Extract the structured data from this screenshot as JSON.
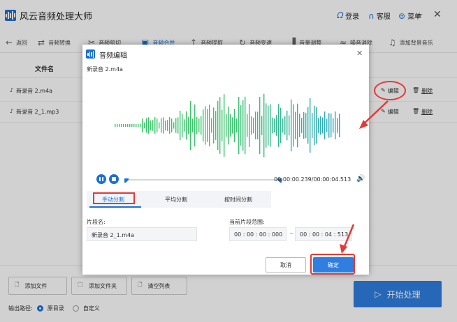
{
  "app": {
    "title": "风云音频处理大师"
  },
  "titlebar": {
    "login": "登录",
    "service": "客服",
    "menu": "菜单"
  },
  "toolbar": {
    "back": "返回",
    "items": [
      "音频转换",
      "音频剪切",
      "音频合并",
      "音频提取",
      "音频变速",
      "音量调整",
      "噪音消除",
      "添加背景音乐"
    ]
  },
  "table": {
    "header_name": "文件名",
    "rows": [
      {
        "name": "新录音 2.m4a",
        "edit": "编辑",
        "delete": "删除"
      },
      {
        "name": "新录音 2_1.mp3",
        "edit": "编辑",
        "delete": "删除"
      }
    ]
  },
  "bottom": {
    "add_file": "添加文件",
    "add_folder": "添加文件夹",
    "clear_list": "清空列表",
    "start": "开始处理",
    "output_label": "输出路径:",
    "output_options": [
      "原目录",
      "自定义"
    ]
  },
  "dialog": {
    "title": "音频编辑",
    "file": "新录音 2.m4a",
    "time": "00:00:00.239/00:00:04.513",
    "progress": 0.0,
    "tabs": [
      "手动分割",
      "平均分割",
      "按时间分割"
    ],
    "active_tab": 0,
    "segment_name_label": "片段名:",
    "segment_name_value": "新录音 2_1.m4a",
    "range_label": "当前片段范围:",
    "range_start": "00 : 00 : 00 : 000",
    "range_end": "00 : 00 : 04 : 513",
    "cancel": "取消",
    "ok": "确定"
  },
  "colors": {
    "accent": "#1a6fd9",
    "annotation": "#e53935",
    "wave_green": "#3cc46a",
    "wave_teal": "#2fa5c0"
  }
}
